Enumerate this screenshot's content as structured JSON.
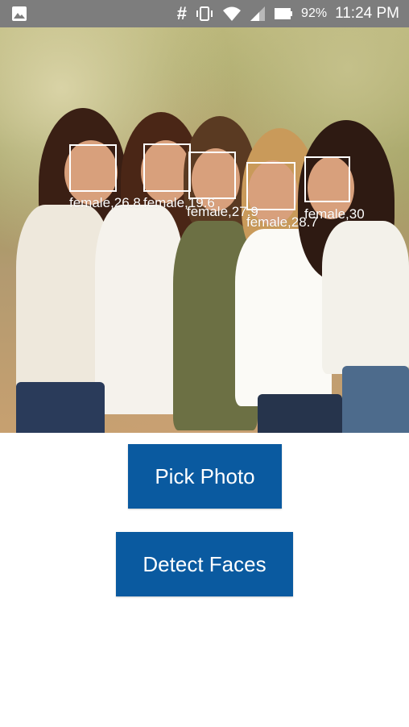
{
  "status_bar": {
    "hash_symbol": "#",
    "battery_percent": "92%",
    "time": "11:24 PM"
  },
  "photo": {
    "faces": [
      {
        "label": "female,26.8"
      },
      {
        "label": "female,19.6"
      },
      {
        "label": "female,27.9"
      },
      {
        "label": "female,28.7"
      },
      {
        "label": "female,30"
      }
    ]
  },
  "buttons": {
    "pick_photo": "Pick Photo",
    "detect_faces": "Detect Faces"
  },
  "colors": {
    "accent": "#0a5aa0",
    "status_bar": "#7d7d7d"
  }
}
